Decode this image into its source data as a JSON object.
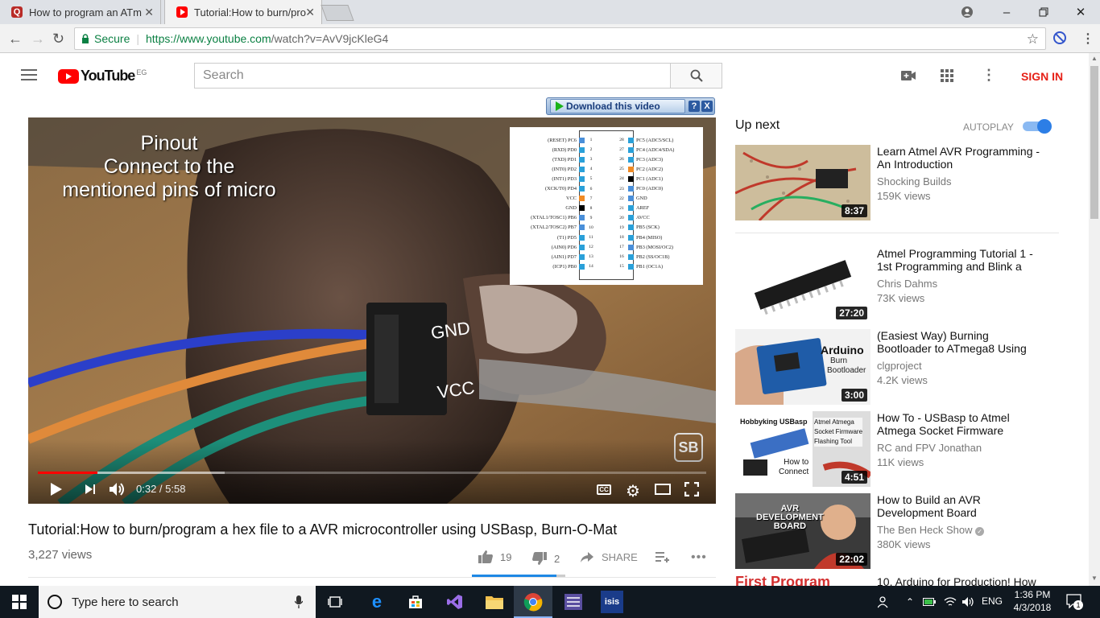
{
  "browser": {
    "tabs": [
      {
        "title": "How to program an ATm",
        "active": false
      },
      {
        "title": "Tutorial:How to burn/pro",
        "active": true
      }
    ],
    "secure_label": "Secure",
    "url_prefix": "https://www.youtube.com",
    "url_path": "/watch?v=AvV9jcKleG4",
    "window_controls": [
      "account-icon",
      "minimize-icon",
      "restore-icon",
      "close-icon"
    ]
  },
  "youtube": {
    "logo_text": "YouTube",
    "region": "EG",
    "search_placeholder": "Search",
    "sign_in": "SIGN IN",
    "download_label": "Download this video",
    "download_help": "?",
    "download_close": "X"
  },
  "player": {
    "overlay_line1": "Pinout",
    "overlay_line2": "Connect to the",
    "overlay_line3": "mentioned pins of micro",
    "gnd_label": "GND",
    "vcc_label": "VCC",
    "time": "0:32 / 5:58",
    "progress": 0.089,
    "buffer": 0.28,
    "watermark": "SB",
    "pinout_left": [
      {
        "name": "(RESET) PC6",
        "num": "1"
      },
      {
        "name": "(RXD) PD0",
        "num": "2"
      },
      {
        "name": "(TXD) PD1",
        "num": "3"
      },
      {
        "name": "(INT0) PD2",
        "num": "4"
      },
      {
        "name": "(INT1) PD3",
        "num": "5"
      },
      {
        "name": "(XCK/T0) PD4",
        "num": "6"
      },
      {
        "name": "VCC",
        "num": "7"
      },
      {
        "name": "GND",
        "num": "8"
      },
      {
        "name": "(XTAL1/TOSC1) PB6",
        "num": "9"
      },
      {
        "name": "(XTAL2/TOSC2) PB7",
        "num": "10"
      },
      {
        "name": "(T1) PD5",
        "num": "11"
      },
      {
        "name": "(AIN0) PD6",
        "num": "12"
      },
      {
        "name": "(AIN1) PD7",
        "num": "13"
      },
      {
        "name": "(ICP1) PB0",
        "num": "14"
      }
    ],
    "pinout_right": [
      {
        "name": "PC5 (ADC5/SCL)",
        "num": "28"
      },
      {
        "name": "PC4 (ADC4/SDA)",
        "num": "27"
      },
      {
        "name": "PC3 (ADC3)",
        "num": "26"
      },
      {
        "name": "PC2 (ADC2)",
        "num": "25"
      },
      {
        "name": "PC1 (ADC1)",
        "num": "24"
      },
      {
        "name": "PC0 (ADC0)",
        "num": "23"
      },
      {
        "name": "GND",
        "num": "22"
      },
      {
        "name": "AREF",
        "num": "21"
      },
      {
        "name": "AVCC",
        "num": "20"
      },
      {
        "name": "PB5 (SCK)",
        "num": "19"
      },
      {
        "name": "PB4 (MISO)",
        "num": "18"
      },
      {
        "name": "PB3 (MOSI/OC2)",
        "num": "17"
      },
      {
        "name": "PB2 (SS/OC1B)",
        "num": "16"
      },
      {
        "name": "PB1 (OC1A)",
        "num": "15"
      }
    ]
  },
  "video": {
    "title": "Tutorial:How to burn/program a hex file to a AVR microcontroller using USBasp, Burn-O-Mat",
    "views": "3,227 views",
    "likes": "19",
    "dislikes": "2",
    "share": "SHARE",
    "like_ratio": 0.905
  },
  "sidebar": {
    "up_next": "Up next",
    "autoplay": "AUTOPLAY",
    "autoplay_on": true,
    "items": [
      {
        "title": "Learn Atmel AVR Programming - An Introduction",
        "channel": "Shocking Builds",
        "views": "159K views",
        "duration": "8:37",
        "verified": false
      },
      {
        "title": "Atmel Programming Tutorial 1 - 1st Programming and Blink a",
        "channel": "Chris Dahms",
        "views": "73K views",
        "duration": "27:20",
        "verified": false
      },
      {
        "title": "(Easiest Way) Burning Bootloader to ATmega8 Using",
        "channel": "clgproject",
        "views": "4.2K views",
        "duration": "3:00",
        "verified": false
      },
      {
        "title": "How To - USBasp to Atmel Atmega Socket Firmware",
        "channel": "RC and FPV Jonathan",
        "views": "11K views",
        "duration": "4:51",
        "verified": false
      },
      {
        "title": "How to Build an AVR Development Board",
        "channel": "The Ben Heck Show",
        "views": "380K views",
        "duration": "22:02",
        "verified": true
      },
      {
        "title": "10. Arduino for Production! How",
        "channel": "",
        "views": "",
        "duration": "",
        "verified": false
      }
    ],
    "thumb_texts": {
      "arduino": "Arduino",
      "burn": "Burn",
      "bootloader": "Bootloader",
      "hobbyking": "Hobbyking USBasp",
      "socket1": "Atmel Atmega",
      "socket2": "Socket Firmware",
      "socket3": "Flashing Tool",
      "howto1": "How to",
      "howto2": "Connect",
      "avrdev1": "AVR",
      "avrdev2": "DEVELOPMENT",
      "avrdev3": "BOARD",
      "firstprog": "First Program"
    }
  },
  "taskbar": {
    "search_placeholder": "Type here to search",
    "language": "ENG",
    "time": "1:36 PM",
    "date": "4/3/2018",
    "notifications": "1"
  }
}
